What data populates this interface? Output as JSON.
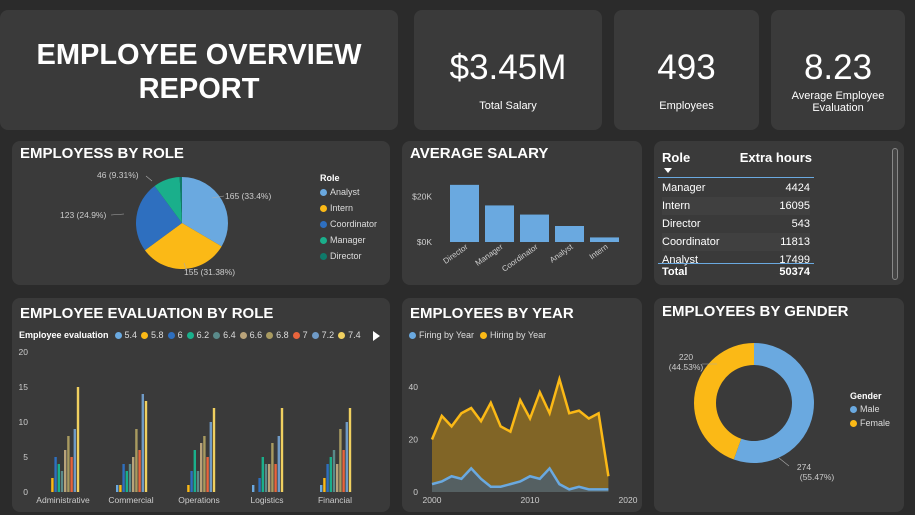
{
  "report": {
    "title_line1": "EMPLOYEE OVERVIEW",
    "title_line2": "REPORT"
  },
  "kpis": [
    {
      "value": "$3.45M",
      "label": "Total Salary"
    },
    {
      "value": "493",
      "label": "Employees"
    },
    {
      "value": "8.23",
      "label_line1": "Average Employee",
      "label_line2": "Evaluation"
    }
  ],
  "role_pie": {
    "title": "EMPLOYESS BY ROLE",
    "legend_title": "Role",
    "labels": [
      "165 (33.4%)",
      "155 (31.38%)",
      "123 (24.9%)",
      "46 (9.31%)"
    ]
  },
  "avg_salary": {
    "title": "AVERAGE SALARY"
  },
  "extra_hours": {
    "col_role": "Role",
    "col_hours": "Extra hours",
    "rows": [
      {
        "role": "Manager",
        "hours": "4424"
      },
      {
        "role": "Intern",
        "hours": "16095"
      },
      {
        "role": "Director",
        "hours": "543"
      },
      {
        "role": "Coordinator",
        "hours": "11813"
      },
      {
        "role": "Analyst",
        "hours": "17499"
      }
    ],
    "total_label": "Total",
    "total_value": "50374"
  },
  "eval_by_role": {
    "title": "EMPLOYEE EVALUATION BY ROLE",
    "legend_title": "Employee evaluation"
  },
  "by_year": {
    "title": "EMPLOYEES BY YEAR"
  },
  "by_gender": {
    "title": "EMPLOYEES BY GENDER",
    "legend_title": "Gender",
    "female_label_1": "220",
    "female_label_2": "(44.53%)",
    "male_label_1": "274",
    "male_label_2": "(55.47%)"
  },
  "colors": {
    "blue": "#6aa9e0",
    "yellow": "#fbb916",
    "darkblue": "#2e6fbf",
    "teal": "#1aaf8b",
    "green": "#0f7a6a"
  },
  "chart_data": [
    {
      "type": "pie",
      "categories": [
        "Analyst",
        "Intern",
        "Coordinator",
        "Manager",
        "Director"
      ],
      "values": [
        165,
        155,
        123,
        46,
        4
      ],
      "colors": [
        "#6aa9e0",
        "#fbb916",
        "#2e6fbf",
        "#1aaf8b",
        "#0f7a6a"
      ],
      "legend": "right"
    },
    {
      "type": "bar",
      "categories": [
        "Director",
        "Manager",
        "Coordinator",
        "Analyst",
        "Intern"
      ],
      "values": [
        25000,
        16000,
        12000,
        7000,
        2000
      ],
      "yticks": [
        "$0K",
        "$20K"
      ],
      "ylim": [
        0,
        28000
      ],
      "color": "#6aa9e0"
    },
    {
      "type": "bar",
      "categories": [
        "Administrative",
        "Commercial",
        "Operations",
        "Logistics",
        "Financial"
      ],
      "series": [
        {
          "name": "5.4",
          "color": "#6aa9e0",
          "values": [
            0,
            1,
            0,
            1,
            1
          ]
        },
        {
          "name": "5.8",
          "color": "#fbb916",
          "values": [
            2,
            1,
            1,
            0,
            2
          ]
        },
        {
          "name": "6",
          "color": "#2e6fbf",
          "values": [
            5,
            4,
            3,
            2,
            4
          ]
        },
        {
          "name": "6.2",
          "color": "#1aaf8b",
          "values": [
            4,
            3,
            6,
            5,
            5
          ]
        },
        {
          "name": "6.4",
          "color": "#5a8a8a",
          "values": [
            3,
            4,
            3,
            4,
            6
          ]
        },
        {
          "name": "6.6",
          "color": "#b9a37a",
          "values": [
            6,
            5,
            7,
            4,
            4
          ]
        },
        {
          "name": "6.8",
          "color": "#a89a60",
          "values": [
            8,
            9,
            8,
            7,
            9
          ]
        },
        {
          "name": "7",
          "color": "#e8643c",
          "values": [
            5,
            6,
            5,
            4,
            6
          ]
        },
        {
          "name": "7.2",
          "color": "#6f9ac6",
          "values": [
            9,
            14,
            10,
            8,
            10
          ]
        },
        {
          "name": "7.4",
          "color": "#f0d060",
          "values": [
            15,
            13,
            12,
            12,
            12
          ]
        }
      ],
      "yticks": [
        0,
        5,
        10,
        15,
        20
      ],
      "ylim": [
        0,
        20
      ],
      "legend": "top"
    },
    {
      "type": "area",
      "x": [
        2000,
        2001,
        2002,
        2003,
        2004,
        2005,
        2006,
        2007,
        2008,
        2009,
        2010,
        2011,
        2012,
        2013,
        2014,
        2015,
        2016,
        2017,
        2018
      ],
      "series": [
        {
          "name": "Firing by Year",
          "color": "#6aa9e0",
          "values": [
            3,
            4,
            6,
            5,
            9,
            5,
            2,
            2,
            3,
            4,
            6,
            5,
            9,
            3,
            1,
            2,
            1,
            1,
            1
          ]
        },
        {
          "name": "Hiring by Year",
          "color": "#fbb916",
          "values": [
            20,
            29,
            25,
            30,
            32,
            27,
            34,
            25,
            23,
            35,
            28,
            38,
            30,
            43,
            30,
            31,
            28,
            30,
            6
          ]
        }
      ],
      "xticks": [
        2000,
        2010,
        2020
      ],
      "yticks": [
        0,
        20,
        40
      ],
      "ylim": [
        0,
        48
      ],
      "legend": "top"
    },
    {
      "type": "pie",
      "categories": [
        "Male",
        "Female"
      ],
      "values": [
        274,
        220
      ],
      "colors": [
        "#6aa9e0",
        "#fbb916"
      ],
      "legend": "right"
    }
  ]
}
